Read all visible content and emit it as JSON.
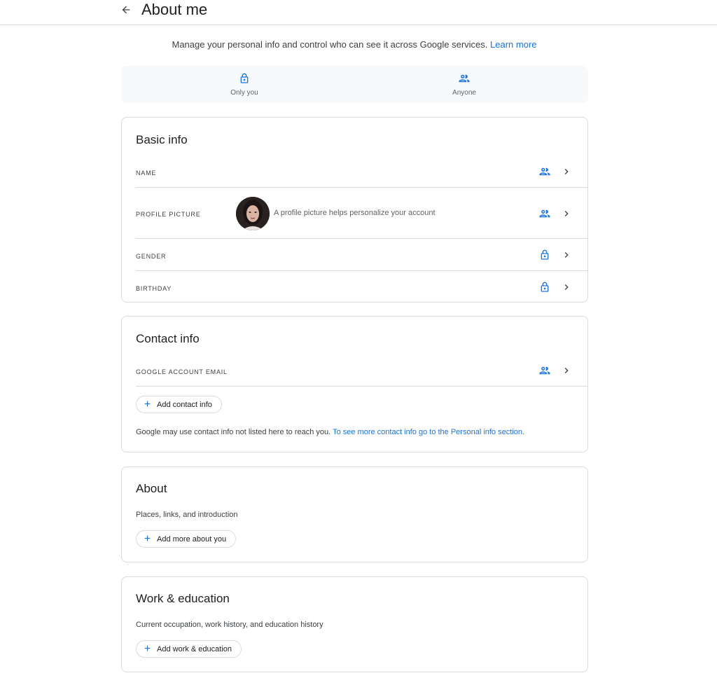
{
  "header": {
    "title": "About me",
    "back_icon": "arrow-back-icon"
  },
  "intro": {
    "text": "Manage your personal info and control who can see it across Google services.",
    "link": "Learn more"
  },
  "legend": {
    "only_you": {
      "icon": "lock-icon",
      "label": "Only you"
    },
    "anyone": {
      "icon": "people-icon",
      "label": "Anyone"
    }
  },
  "basic_info": {
    "title": "Basic info",
    "rows": [
      {
        "label": "NAME",
        "visibility": "anyone"
      },
      {
        "label": "PROFILE PICTURE",
        "hint": "A profile picture helps personalize your account",
        "visibility": "anyone"
      },
      {
        "label": "GENDER",
        "visibility": "only_you"
      },
      {
        "label": "BIRTHDAY",
        "visibility": "only_you"
      }
    ]
  },
  "contact_info": {
    "title": "Contact info",
    "rows": [
      {
        "label": "GOOGLE ACCOUNT EMAIL",
        "visibility": "anyone"
      }
    ],
    "add_button": "Add contact info",
    "note": "Google may use contact info not listed here to reach you.",
    "note_link": "To see more contact info go to the Personal info section."
  },
  "about": {
    "title": "About",
    "subtitle": "Places, links, and introduction",
    "add_button": "Add more about you"
  },
  "work_education": {
    "title": "Work & education",
    "subtitle": "Current occupation, work history, and education history",
    "add_button": "Add work & education"
  },
  "colors": {
    "accent": "#1a73e8",
    "border": "#dadce0",
    "legend_bg": "#f8f9fa"
  }
}
